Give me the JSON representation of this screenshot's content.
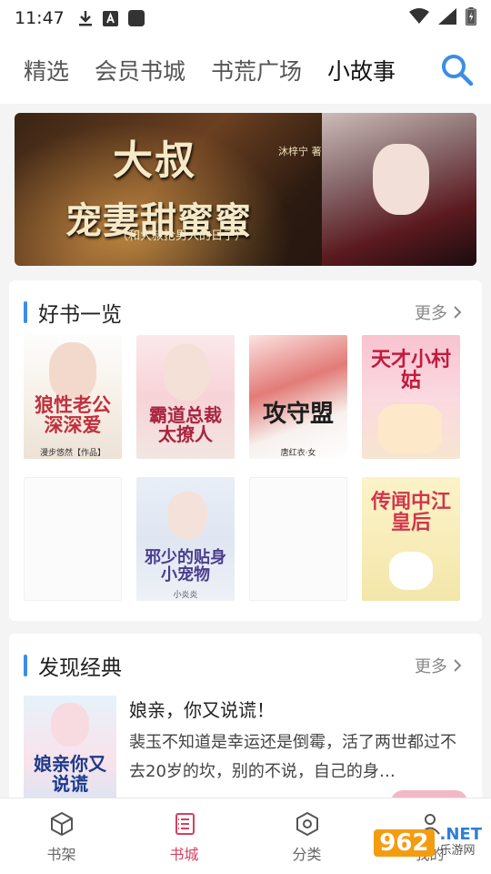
{
  "status_bar": {
    "time": "11:47",
    "icons": [
      "download-icon",
      "text-a-icon",
      "square-icon",
      "wifi-icon",
      "signal-icon",
      "battery-icon"
    ]
  },
  "top_nav": {
    "tabs": [
      {
        "label": "精选"
      },
      {
        "label": "会员书城"
      },
      {
        "label": "书荒广场"
      },
      {
        "label": "小故事"
      }
    ],
    "active_tab": "小故事",
    "search_icon": "search-icon",
    "accent_color": "#3a8de8"
  },
  "banner": {
    "title_line1": "大叔",
    "title_line2": "宠妻甜蜜蜜",
    "subtitle": "（和大叔抢男人的日子）",
    "stamp": "沐梓宁 著"
  },
  "good_books": {
    "title": "好书一览",
    "more": "更多",
    "books": [
      {
        "cover_title": "狼性老公深深爱",
        "cover_author": "漫步悠然【作品】"
      },
      {
        "cover_title": "霸道总裁太撩人",
        "cover_author": ""
      },
      {
        "cover_title": "攻守盟",
        "cover_author": "唐红衣·女"
      },
      {
        "cover_title": "天才小村姑",
        "cover_author": ""
      },
      {
        "cover_title": "",
        "cover_author": ""
      },
      {
        "cover_title": "邪少的贴身小宠物",
        "cover_author": "小炎炎"
      },
      {
        "cover_title": "",
        "cover_author": ""
      },
      {
        "cover_title": "传闻中江皇后",
        "cover_author": ""
      }
    ]
  },
  "discover": {
    "title": "发现经典",
    "more": "更多",
    "item": {
      "title": "娘亲，你又说谎！",
      "description": "裴玉不知道是幸运还是倒霉，活了两世都过不去20岁的坎，别的不说，自己的身…",
      "cover_title": "娘亲你又说谎"
    }
  },
  "bottom_nav": {
    "items": [
      {
        "label": "书架",
        "icon": "cube-icon"
      },
      {
        "label": "书城",
        "icon": "book-list-icon"
      },
      {
        "label": "分类",
        "icon": "hexagon-icon"
      },
      {
        "label": "我的",
        "icon": "user-icon"
      }
    ],
    "active": "书城",
    "active_color": "#d2415f"
  },
  "watermark": {
    "logo": "962",
    "domain": ".NET",
    "site": "乐游网"
  }
}
